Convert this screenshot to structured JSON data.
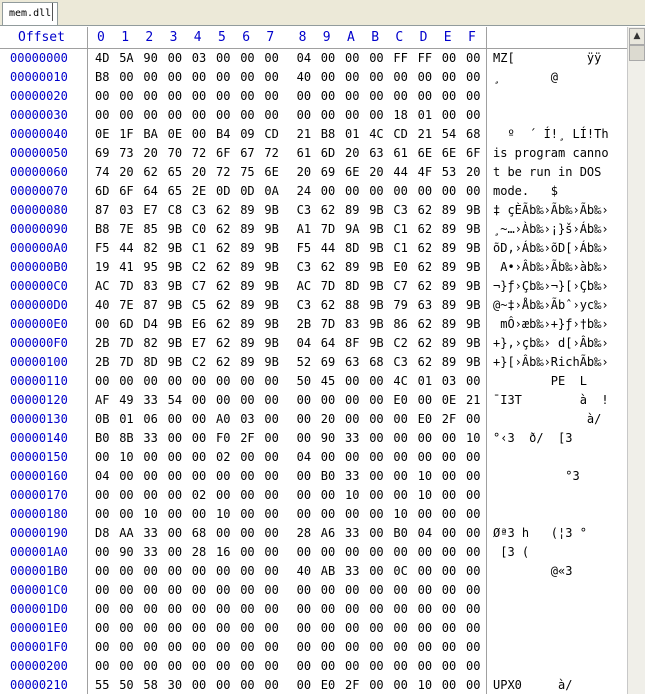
{
  "tab": {
    "label": "mem.dll"
  },
  "header": {
    "offset_label": "Offset",
    "columns": [
      "0",
      "1",
      "2",
      "3",
      "4",
      "5",
      "6",
      "7",
      "8",
      "9",
      "A",
      "B",
      "C",
      "D",
      "E",
      "F"
    ]
  },
  "scroll": {
    "up_icon": "triangle-up-icon"
  },
  "rows": [
    {
      "offset": "00000000",
      "hex": [
        "4D",
        "5A",
        "90",
        "00",
        "03",
        "00",
        "00",
        "00",
        "04",
        "00",
        "00",
        "00",
        "FF",
        "FF",
        "00",
        "00"
      ],
      "ascii": "MZ[          ÿÿ"
    },
    {
      "offset": "00000010",
      "hex": [
        "B8",
        "00",
        "00",
        "00",
        "00",
        "00",
        "00",
        "00",
        "40",
        "00",
        "00",
        "00",
        "00",
        "00",
        "00",
        "00"
      ],
      "ascii": "¸       @"
    },
    {
      "offset": "00000020",
      "hex": [
        "00",
        "00",
        "00",
        "00",
        "00",
        "00",
        "00",
        "00",
        "00",
        "00",
        "00",
        "00",
        "00",
        "00",
        "00",
        "00"
      ],
      "ascii": ""
    },
    {
      "offset": "00000030",
      "hex": [
        "00",
        "00",
        "00",
        "00",
        "00",
        "00",
        "00",
        "00",
        "00",
        "00",
        "00",
        "00",
        "18",
        "01",
        "00",
        "00"
      ],
      "ascii": ""
    },
    {
      "offset": "00000040",
      "hex": [
        "0E",
        "1F",
        "BA",
        "0E",
        "00",
        "B4",
        "09",
        "CD",
        "21",
        "B8",
        "01",
        "4C",
        "CD",
        "21",
        "54",
        "68"
      ],
      "ascii": "  º  ´ Í!¸ LÍ!Th"
    },
    {
      "offset": "00000050",
      "hex": [
        "69",
        "73",
        "20",
        "70",
        "72",
        "6F",
        "67",
        "72",
        "61",
        "6D",
        "20",
        "63",
        "61",
        "6E",
        "6E",
        "6F"
      ],
      "ascii": "is program canno"
    },
    {
      "offset": "00000060",
      "hex": [
        "74",
        "20",
        "62",
        "65",
        "20",
        "72",
        "75",
        "6E",
        "20",
        "69",
        "6E",
        "20",
        "44",
        "4F",
        "53",
        "20"
      ],
      "ascii": "t be run in DOS "
    },
    {
      "offset": "00000070",
      "hex": [
        "6D",
        "6F",
        "64",
        "65",
        "2E",
        "0D",
        "0D",
        "0A",
        "24",
        "00",
        "00",
        "00",
        "00",
        "00",
        "00",
        "00"
      ],
      "ascii": "mode.   $"
    },
    {
      "offset": "00000080",
      "hex": [
        "87",
        "03",
        "E7",
        "C8",
        "C3",
        "62",
        "89",
        "9B",
        "C3",
        "62",
        "89",
        "9B",
        "C3",
        "62",
        "89",
        "9B"
      ],
      "ascii": "‡ çÈÃb‰›Ãb‰›Ãb‰›"
    },
    {
      "offset": "00000090",
      "hex": [
        "B8",
        "7E",
        "85",
        "9B",
        "C0",
        "62",
        "89",
        "9B",
        "A1",
        "7D",
        "9A",
        "9B",
        "C1",
        "62",
        "89",
        "9B"
      ],
      "ascii": "¸~…›Àb‰›¡}š›Áb‰›"
    },
    {
      "offset": "000000A0",
      "hex": [
        "F5",
        "44",
        "82",
        "9B",
        "C1",
        "62",
        "89",
        "9B",
        "F5",
        "44",
        "8D",
        "9B",
        "C1",
        "62",
        "89",
        "9B"
      ],
      "ascii": "õD‚›Áb‰›õD[›Áb‰›"
    },
    {
      "offset": "000000B0",
      "hex": [
        "19",
        "41",
        "95",
        "9B",
        "C2",
        "62",
        "89",
        "9B",
        "C3",
        "62",
        "89",
        "9B",
        "E0",
        "62",
        "89",
        "9B"
      ],
      "ascii": " A•›Âb‰›Ãb‰›àb‰›"
    },
    {
      "offset": "000000C0",
      "hex": [
        "AC",
        "7D",
        "83",
        "9B",
        "C7",
        "62",
        "89",
        "9B",
        "AC",
        "7D",
        "8D",
        "9B",
        "C7",
        "62",
        "89",
        "9B"
      ],
      "ascii": "¬}ƒ›Çb‰›¬}[›Çb‰›"
    },
    {
      "offset": "000000D0",
      "hex": [
        "40",
        "7E",
        "87",
        "9B",
        "C5",
        "62",
        "89",
        "9B",
        "C3",
        "62",
        "88",
        "9B",
        "79",
        "63",
        "89",
        "9B"
      ],
      "ascii": "@~‡›Åb‰›Ãbˆ›yc‰›"
    },
    {
      "offset": "000000E0",
      "hex": [
        "00",
        "6D",
        "D4",
        "9B",
        "E6",
        "62",
        "89",
        "9B",
        "2B",
        "7D",
        "83",
        "9B",
        "86",
        "62",
        "89",
        "9B"
      ],
      "ascii": " mÔ›æb‰›+}ƒ›†b‰›"
    },
    {
      "offset": "000000F0",
      "hex": [
        "2B",
        "7D",
        "82",
        "9B",
        "E7",
        "62",
        "89",
        "9B",
        "04",
        "64",
        "8F",
        "9B",
        "C2",
        "62",
        "89",
        "9B"
      ],
      "ascii": "+}‚›çb‰› d[›Âb‰›"
    },
    {
      "offset": "00000100",
      "hex": [
        "2B",
        "7D",
        "8D",
        "9B",
        "C2",
        "62",
        "89",
        "9B",
        "52",
        "69",
        "63",
        "68",
        "C3",
        "62",
        "89",
        "9B"
      ],
      "ascii": "+}[›Âb‰›RichÃb‰›"
    },
    {
      "offset": "00000110",
      "hex": [
        "00",
        "00",
        "00",
        "00",
        "00",
        "00",
        "00",
        "00",
        "50",
        "45",
        "00",
        "00",
        "4C",
        "01",
        "03",
        "00"
      ],
      "ascii": "        PE  L"
    },
    {
      "offset": "00000120",
      "hex": [
        "AF",
        "49",
        "33",
        "54",
        "00",
        "00",
        "00",
        "00",
        "00",
        "00",
        "00",
        "00",
        "E0",
        "00",
        "0E",
        "21"
      ],
      "ascii": "¯I3T        à  !"
    },
    {
      "offset": "00000130",
      "hex": [
        "0B",
        "01",
        "06",
        "00",
        "00",
        "A0",
        "03",
        "00",
        "00",
        "20",
        "00",
        "00",
        "00",
        "E0",
        "2F",
        "00"
      ],
      "ascii": "             à/"
    },
    {
      "offset": "00000140",
      "hex": [
        "B0",
        "8B",
        "33",
        "00",
        "00",
        "F0",
        "2F",
        "00",
        "00",
        "90",
        "33",
        "00",
        "00",
        "00",
        "00",
        "10"
      ],
      "ascii": "°‹3  ð/  [3"
    },
    {
      "offset": "00000150",
      "hex": [
        "00",
        "10",
        "00",
        "00",
        "00",
        "02",
        "00",
        "00",
        "04",
        "00",
        "00",
        "00",
        "00",
        "00",
        "00",
        "00"
      ],
      "ascii": ""
    },
    {
      "offset": "00000160",
      "hex": [
        "04",
        "00",
        "00",
        "00",
        "00",
        "00",
        "00",
        "00",
        "00",
        "B0",
        "33",
        "00",
        "00",
        "10",
        "00",
        "00"
      ],
      "ascii": "          °3"
    },
    {
      "offset": "00000170",
      "hex": [
        "00",
        "00",
        "00",
        "00",
        "02",
        "00",
        "00",
        "00",
        "00",
        "00",
        "10",
        "00",
        "00",
        "10",
        "00",
        "00"
      ],
      "ascii": ""
    },
    {
      "offset": "00000180",
      "hex": [
        "00",
        "00",
        "10",
        "00",
        "00",
        "10",
        "00",
        "00",
        "00",
        "00",
        "00",
        "00",
        "10",
        "00",
        "00",
        "00"
      ],
      "ascii": ""
    },
    {
      "offset": "00000190",
      "hex": [
        "D8",
        "AA",
        "33",
        "00",
        "68",
        "00",
        "00",
        "00",
        "28",
        "A6",
        "33",
        "00",
        "B0",
        "04",
        "00",
        "00"
      ],
      "ascii": "Øª3 h   (¦3 °"
    },
    {
      "offset": "000001A0",
      "hex": [
        "00",
        "90",
        "33",
        "00",
        "28",
        "16",
        "00",
        "00",
        "00",
        "00",
        "00",
        "00",
        "00",
        "00",
        "00",
        "00"
      ],
      "ascii": " [3 ("
    },
    {
      "offset": "000001B0",
      "hex": [
        "00",
        "00",
        "00",
        "00",
        "00",
        "00",
        "00",
        "00",
        "40",
        "AB",
        "33",
        "00",
        "0C",
        "00",
        "00",
        "00"
      ],
      "ascii": "        @«3"
    },
    {
      "offset": "000001C0",
      "hex": [
        "00",
        "00",
        "00",
        "00",
        "00",
        "00",
        "00",
        "00",
        "00",
        "00",
        "00",
        "00",
        "00",
        "00",
        "00",
        "00"
      ],
      "ascii": ""
    },
    {
      "offset": "000001D0",
      "hex": [
        "00",
        "00",
        "00",
        "00",
        "00",
        "00",
        "00",
        "00",
        "00",
        "00",
        "00",
        "00",
        "00",
        "00",
        "00",
        "00"
      ],
      "ascii": ""
    },
    {
      "offset": "000001E0",
      "hex": [
        "00",
        "00",
        "00",
        "00",
        "00",
        "00",
        "00",
        "00",
        "00",
        "00",
        "00",
        "00",
        "00",
        "00",
        "00",
        "00"
      ],
      "ascii": ""
    },
    {
      "offset": "000001F0",
      "hex": [
        "00",
        "00",
        "00",
        "00",
        "00",
        "00",
        "00",
        "00",
        "00",
        "00",
        "00",
        "00",
        "00",
        "00",
        "00",
        "00"
      ],
      "ascii": ""
    },
    {
      "offset": "00000200",
      "hex": [
        "00",
        "00",
        "00",
        "00",
        "00",
        "00",
        "00",
        "00",
        "00",
        "00",
        "00",
        "00",
        "00",
        "00",
        "00",
        "00"
      ],
      "ascii": ""
    },
    {
      "offset": "00000210",
      "hex": [
        "55",
        "50",
        "58",
        "30",
        "00",
        "00",
        "00",
        "00",
        "00",
        "E0",
        "2F",
        "00",
        "00",
        "10",
        "00",
        "00"
      ],
      "ascii": "UPX0     à/"
    }
  ]
}
